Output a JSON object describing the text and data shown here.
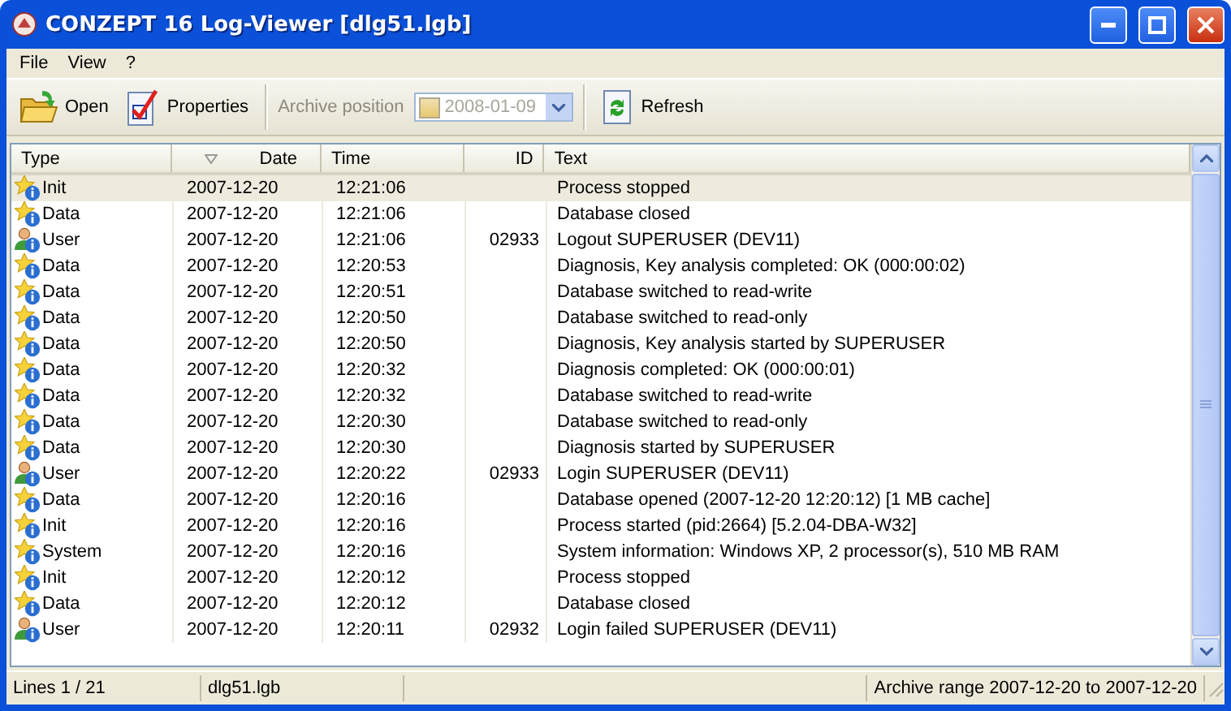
{
  "window": {
    "title": "CONZEPT 16 Log-Viewer [dlg51.lgb]"
  },
  "menu": [
    "File",
    "View",
    "?"
  ],
  "toolbar": {
    "open": "Open",
    "properties": "Properties",
    "archive_label": "Archive position",
    "archive_date": {
      "value": "2008-01-09",
      "checked": false,
      "disabled": true
    },
    "refresh": "Refresh"
  },
  "table": {
    "columns": [
      {
        "label": "Type",
        "sorted": false
      },
      {
        "label": "Date",
        "sorted": true
      },
      {
        "label": "Time",
        "sorted": false
      },
      {
        "label": "ID",
        "sorted": false
      },
      {
        "label": "Text",
        "sorted": false
      }
    ],
    "rows": [
      {
        "kind": "event",
        "type": "Init",
        "date": "2007-12-20",
        "time": "12:21:06",
        "id": "",
        "text": "Process stopped",
        "selected": true
      },
      {
        "kind": "event",
        "type": "Data",
        "date": "2007-12-20",
        "time": "12:21:06",
        "id": "",
        "text": "Database closed",
        "selected": false
      },
      {
        "kind": "user",
        "type": "User",
        "date": "2007-12-20",
        "time": "12:21:06",
        "id": "02933",
        "text": "Logout SUPERUSER (DEV11)",
        "selected": false
      },
      {
        "kind": "event",
        "type": "Data",
        "date": "2007-12-20",
        "time": "12:20:53",
        "id": "",
        "text": "Diagnosis, Key analysis completed: OK (000:00:02)",
        "selected": false
      },
      {
        "kind": "event",
        "type": "Data",
        "date": "2007-12-20",
        "time": "12:20:51",
        "id": "",
        "text": "Database switched to read-write",
        "selected": false
      },
      {
        "kind": "event",
        "type": "Data",
        "date": "2007-12-20",
        "time": "12:20:50",
        "id": "",
        "text": "Database switched to read-only",
        "selected": false
      },
      {
        "kind": "event",
        "type": "Data",
        "date": "2007-12-20",
        "time": "12:20:50",
        "id": "",
        "text": "Diagnosis, Key analysis started by SUPERUSER",
        "selected": false
      },
      {
        "kind": "event",
        "type": "Data",
        "date": "2007-12-20",
        "time": "12:20:32",
        "id": "",
        "text": "Diagnosis completed: OK (000:00:01)",
        "selected": false
      },
      {
        "kind": "event",
        "type": "Data",
        "date": "2007-12-20",
        "time": "12:20:32",
        "id": "",
        "text": "Database switched to read-write",
        "selected": false
      },
      {
        "kind": "event",
        "type": "Data",
        "date": "2007-12-20",
        "time": "12:20:30",
        "id": "",
        "text": "Database switched to read-only",
        "selected": false
      },
      {
        "kind": "event",
        "type": "Data",
        "date": "2007-12-20",
        "time": "12:20:30",
        "id": "",
        "text": "Diagnosis started by SUPERUSER",
        "selected": false
      },
      {
        "kind": "user",
        "type": "User",
        "date": "2007-12-20",
        "time": "12:20:22",
        "id": "02933",
        "text": "Login SUPERUSER (DEV11)",
        "selected": false
      },
      {
        "kind": "event",
        "type": "Data",
        "date": "2007-12-20",
        "time": "12:20:16",
        "id": "",
        "text": "Database opened (2007-12-20  12:20:12) [1 MB cache]",
        "selected": false
      },
      {
        "kind": "event",
        "type": "Init",
        "date": "2007-12-20",
        "time": "12:20:16",
        "id": "",
        "text": "Process started (pid:2664) [5.2.04-DBA-W32]",
        "selected": false
      },
      {
        "kind": "event",
        "type": "System",
        "date": "2007-12-20",
        "time": "12:20:16",
        "id": "",
        "text": "System information: Windows XP, 2 processor(s), 510 MB RAM",
        "selected": false
      },
      {
        "kind": "event",
        "type": "Init",
        "date": "2007-12-20",
        "time": "12:20:12",
        "id": "",
        "text": "Process stopped",
        "selected": false
      },
      {
        "kind": "event",
        "type": "Data",
        "date": "2007-12-20",
        "time": "12:20:12",
        "id": "",
        "text": "Database closed",
        "selected": false
      },
      {
        "kind": "user",
        "type": "User",
        "date": "2007-12-20",
        "time": "12:20:11",
        "id": "02932",
        "text": "Login failed SUPERUSER (DEV11)",
        "selected": false
      }
    ]
  },
  "status_bar": [
    "Lines 1 / 21",
    "dlg51.lgb",
    "Archive range 2007-12-20 to 2007-12-20"
  ]
}
